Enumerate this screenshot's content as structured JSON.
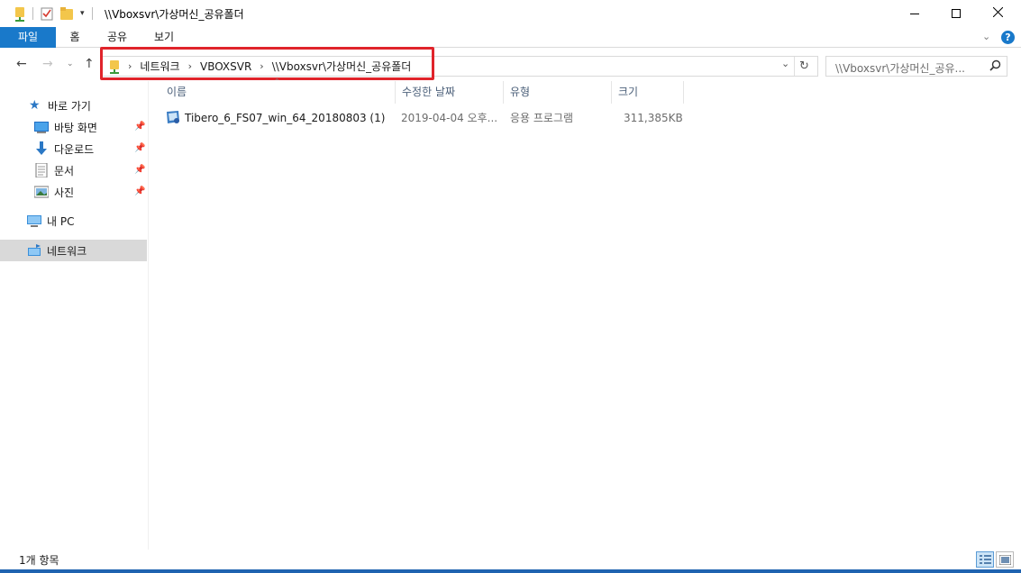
{
  "window": {
    "title": "\\\\Vboxsvr\\가상머신_공유폴더",
    "minimize_icon": "minimize-icon",
    "maximize_icon": "maximize-icon",
    "close_icon": "close-icon"
  },
  "ribbon": {
    "tabs": [
      {
        "label": "파일"
      },
      {
        "label": "홈"
      },
      {
        "label": "공유"
      },
      {
        "label": "보기"
      }
    ],
    "help_label": "?"
  },
  "address": {
    "crumbs": [
      "네트워크",
      "VBOXSVR",
      "\\\\Vboxsvr\\가상머신_공유폴더"
    ],
    "refresh_icon": "refresh-icon"
  },
  "search": {
    "placeholder": "\\\\Vboxsvr\\가상머신_공유..."
  },
  "navpane": {
    "quick_access": "바로 가기",
    "items": [
      {
        "label": "바탕 화면"
      },
      {
        "label": "다운로드"
      },
      {
        "label": "문서"
      },
      {
        "label": "사진"
      }
    ],
    "this_pc": "내 PC",
    "network": "네트워크"
  },
  "columns": {
    "name": "이름",
    "date": "수정한 날짜",
    "type": "유형",
    "size": "크기"
  },
  "files": [
    {
      "name": "Tibero_6_FS07_win_64_20180803 (1)",
      "date": "2019-04-04 오후...",
      "type": "응용 프로그램",
      "size": "311,385KB"
    }
  ],
  "status": {
    "count": "1개 항목"
  },
  "colors": {
    "accent": "#1979ca",
    "highlight_box": "#e0242b",
    "selection": "#d9d9d9"
  }
}
